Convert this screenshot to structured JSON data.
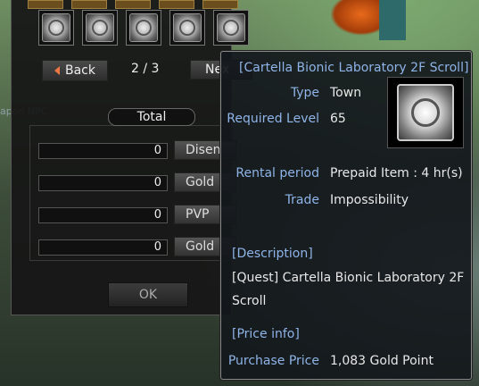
{
  "background": {
    "npc_text": "apon NPC"
  },
  "slots": {
    "count": 5,
    "icon": "scroll-icon"
  },
  "pager": {
    "back_label": "Back",
    "page_indicator": "2 / 3",
    "next_label": "Nex"
  },
  "exchange": {
    "total_label": "Total",
    "rows": [
      {
        "value": "0",
        "button": "Disen"
      },
      {
        "value": "0",
        "button": "Gold"
      },
      {
        "value": "0",
        "button": "PVP"
      },
      {
        "value": "0",
        "button": "Gold"
      }
    ],
    "ok_label": "OK"
  },
  "tooltip": {
    "title": "[Cartella Bionic Laboratory 2F Scroll]",
    "type_label": "Type",
    "type_value": "Town",
    "req_level_label": "Required Level",
    "req_level_value": "65",
    "rental_label": "Rental period",
    "rental_value": "Prepaid Item : 4 hr(s)",
    "trade_label": "Trade",
    "trade_value": "Impossibility",
    "description_header": "[Description]",
    "description_text": "[Quest] Cartella Bionic Laboratory 2F Scroll",
    "price_header": "[Price info]",
    "purchase_label": "Purchase Price",
    "purchase_value": "1,083 Gold Point",
    "item_icon": "scroll-icon"
  },
  "colors": {
    "accent_blue": "#8fb4e8",
    "back_arrow": "#ee7744"
  }
}
